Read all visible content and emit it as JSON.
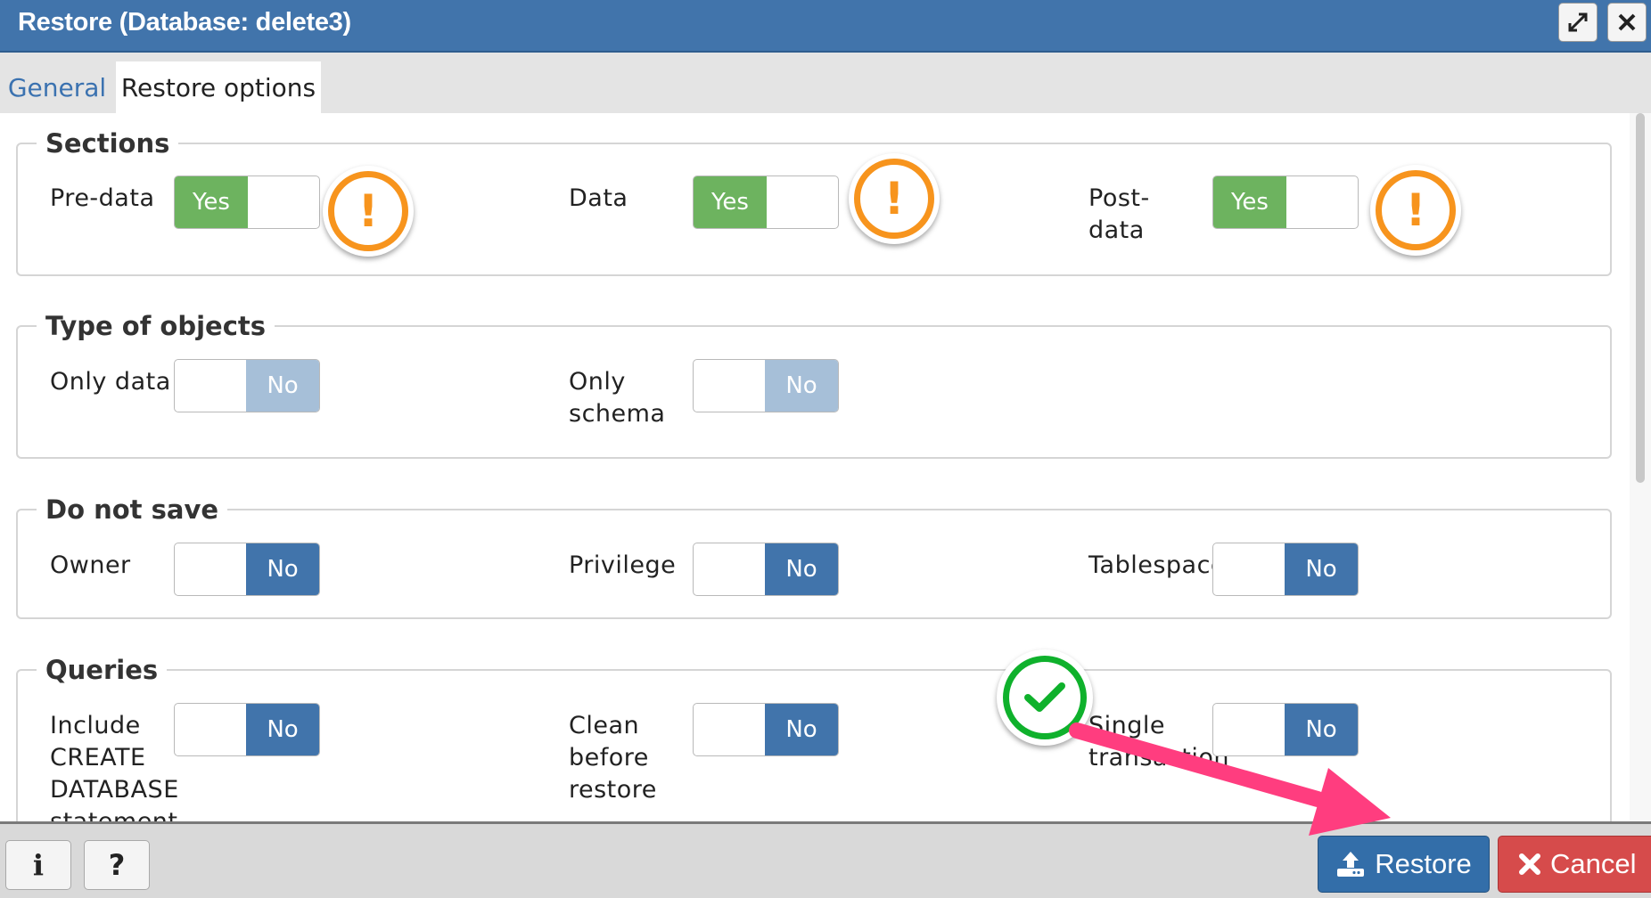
{
  "window": {
    "title": "Restore (Database: delete3)"
  },
  "tabs": [
    {
      "label": "General"
    },
    {
      "label": "Restore options"
    }
  ],
  "sections": {
    "legend": "Sections",
    "items": [
      {
        "label": "Pre-data",
        "value": "Yes"
      },
      {
        "label": "Data",
        "value": "Yes"
      },
      {
        "label_lines": [
          "Post-",
          "data"
        ],
        "value": "Yes"
      }
    ],
    "warning_icon_text": "!"
  },
  "type_of_objects": {
    "legend": "Type of objects",
    "items": [
      {
        "label": "Only data",
        "value": "No"
      },
      {
        "label_lines": [
          "Only",
          "schema"
        ],
        "value": "No"
      }
    ]
  },
  "do_not_save": {
    "legend": "Do not save",
    "items": [
      {
        "label": "Owner",
        "value": "No"
      },
      {
        "label": "Privilege",
        "value": "No"
      },
      {
        "label": "Tablespace",
        "value": "No"
      }
    ]
  },
  "queries": {
    "legend": "Queries",
    "items": [
      {
        "label_lines": [
          "Include",
          "CREATE",
          "DATABASE",
          "statement"
        ],
        "value": "No"
      },
      {
        "label_lines": [
          "Clean",
          "before",
          "restore"
        ],
        "value": "No"
      },
      {
        "label_lines": [
          "Single",
          "transaction"
        ],
        "value": "No"
      }
    ]
  },
  "footer": {
    "info_label": "i",
    "help_label": "?",
    "restore_label": "Restore",
    "cancel_label": "Cancel"
  },
  "colors": {
    "title_bar": "#4174ab",
    "yes_green": "#6db35f",
    "no_blue": "#4174ab",
    "no_disabled": "#a6bfd8",
    "warning_orange": "#f7941d",
    "check_green": "#0fb12c",
    "arrow_pink": "#ff3d7f",
    "restore_button": "#336ea9",
    "cancel_button": "#d64b4b"
  },
  "icons": [
    "maximize-icon",
    "close-icon",
    "warning-icon",
    "checkmark-icon",
    "info-icon",
    "help-icon",
    "upload-icon",
    "x-icon",
    "annotation-arrow"
  ]
}
